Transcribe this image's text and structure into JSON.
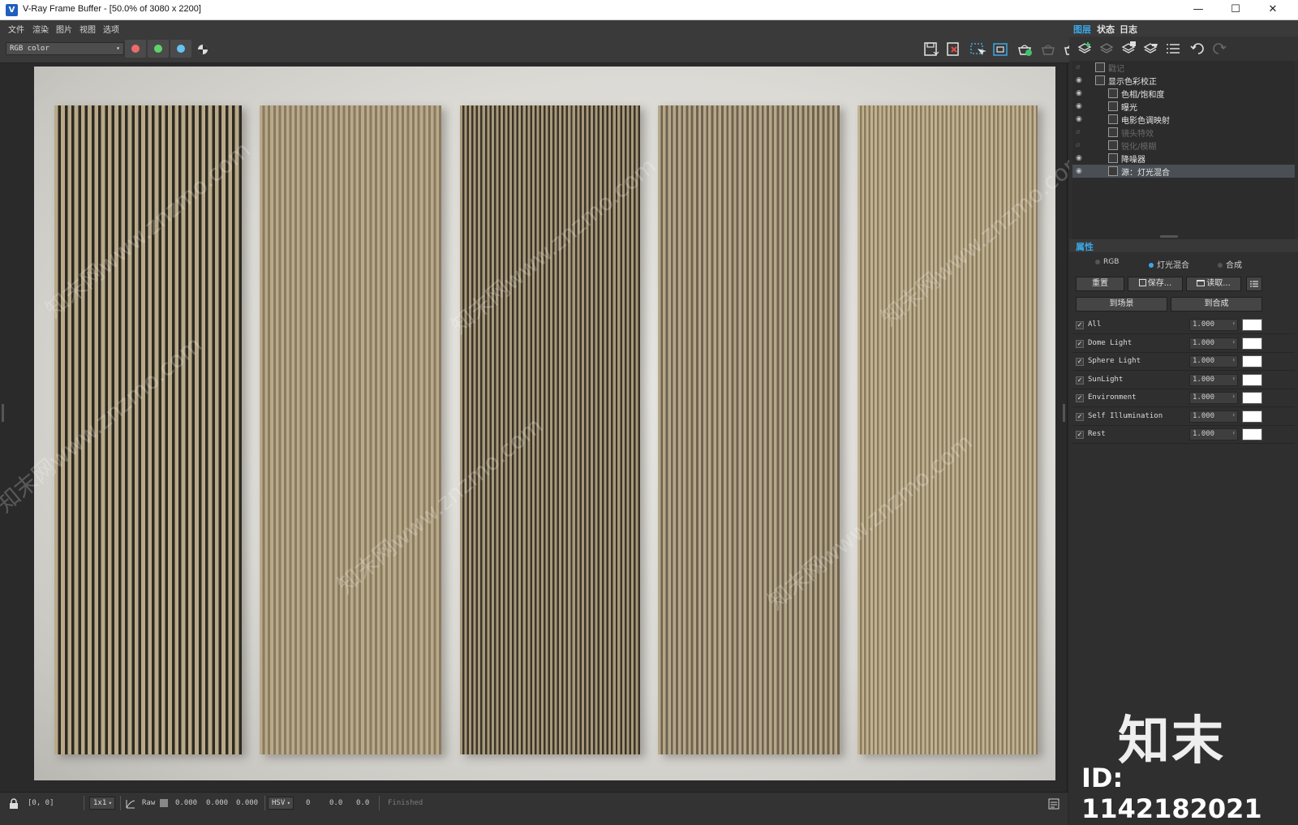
{
  "window": {
    "title": "V-Ray Frame Buffer - [50.0% of 3080 x 2200]",
    "controls": [
      "—",
      "☐",
      "✕"
    ]
  },
  "menu": [
    "文件",
    "渲染",
    "图片",
    "视图",
    "选项"
  ],
  "toolbar": {
    "channel": "RGB color",
    "channel_buttons": [
      {
        "name": "red-channel",
        "color": "#ee6b6b"
      },
      {
        "name": "green-channel",
        "color": "#5fd36b"
      },
      {
        "name": "blue-channel",
        "color": "#65c3f2"
      }
    ]
  },
  "render": {
    "panels": [
      {
        "base": "#b8a988",
        "dark": "#2e2a22",
        "stripes": 28
      },
      {
        "base": "#b9aa8b",
        "dark": "#8a7b5f",
        "stripes": 34
      },
      {
        "base": "#a89a7c",
        "dark": "#3b3428",
        "stripes": 40
      },
      {
        "base": "#b5a789",
        "dark": "#6f6350",
        "stripes": 36
      },
      {
        "base": "#c1b293",
        "dark": "#8b7b5d",
        "stripes": 42
      }
    ],
    "watermark": "知末网www.znzmo.com"
  },
  "statusbar": {
    "coords": "[0, 0]",
    "zoom": "1x1",
    "mode": "Raw",
    "rgb": [
      "0.000",
      "0.000",
      "0.000"
    ],
    "color_space": "HSV",
    "hsv": [
      "0",
      "0.0",
      "0.0"
    ],
    "status": "Finished"
  },
  "right_panel": {
    "tabs": [
      "图层",
      "状态",
      "日志"
    ],
    "layers": [
      {
        "label": "戳记",
        "dim": true,
        "indent": 0
      },
      {
        "label": "显示色彩校正",
        "dim": false,
        "indent": 0
      },
      {
        "label": "色相/饱和度",
        "dim": false,
        "indent": 1
      },
      {
        "label": "曝光",
        "dim": false,
        "indent": 1
      },
      {
        "label": "电影色调映射",
        "dim": false,
        "indent": 1
      },
      {
        "label": "镜头特效",
        "dim": true,
        "indent": 1
      },
      {
        "label": "锐化/模糊",
        "dim": true,
        "indent": 1
      },
      {
        "label": "降噪器",
        "dim": false,
        "indent": 1
      },
      {
        "label": "源：灯光混合",
        "dim": false,
        "indent": 1,
        "selected": true
      }
    ],
    "properties_title": "属性",
    "mode_options": [
      {
        "label": "RGB",
        "selected": false
      },
      {
        "label": "灯光混合",
        "selected": true
      },
      {
        "label": "合成",
        "selected": false
      }
    ],
    "buttons": {
      "reset": "重置",
      "save": "保存...",
      "load": "读取...",
      "to_scene": "到场景",
      "to_composite": "到合成"
    },
    "light_mix": [
      {
        "name": "All",
        "value": "1.000"
      },
      {
        "name": "Dome Light",
        "value": "1.000"
      },
      {
        "name": "Sphere Light",
        "value": "1.000"
      },
      {
        "name": "SunLight",
        "value": "1.000"
      },
      {
        "name": "Environment",
        "value": "1.000"
      },
      {
        "name": "Self Illumination",
        "value": "1.000"
      },
      {
        "name": "Rest",
        "value": "1.000"
      }
    ]
  },
  "branding": {
    "logo": "知末",
    "id": "ID: 1142182021"
  }
}
